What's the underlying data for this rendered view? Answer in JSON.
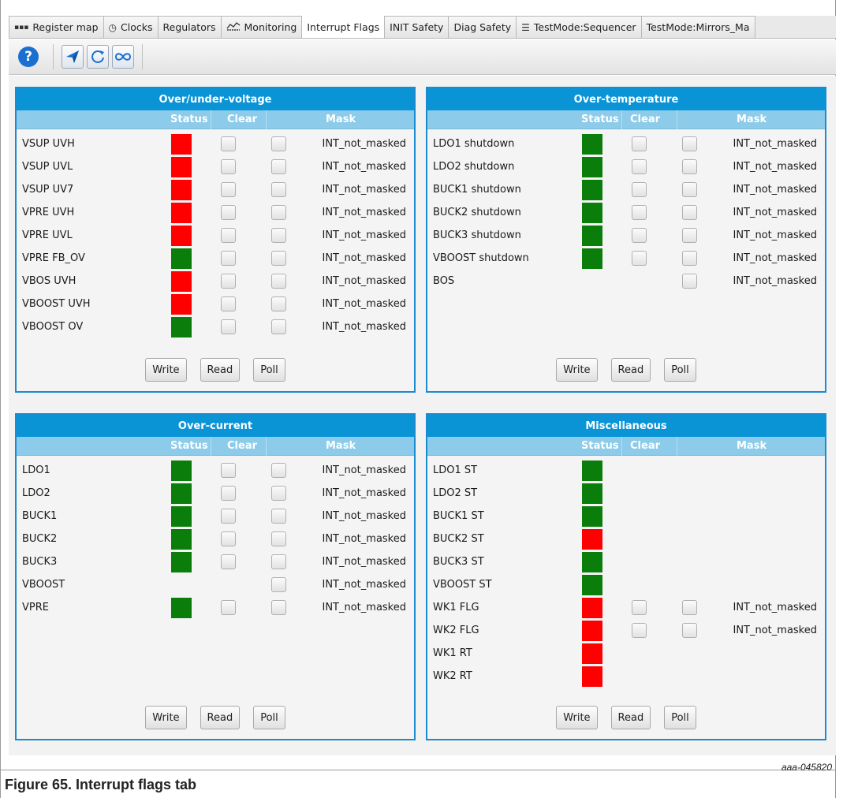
{
  "tabs": [
    {
      "label": "Register map",
      "icon": "register-map-icon"
    },
    {
      "label": "Clocks",
      "icon": "clock-icon"
    },
    {
      "label": "Regulators",
      "icon": ""
    },
    {
      "label": "Monitoring",
      "icon": "monitoring-icon"
    },
    {
      "label": "Interrupt Flags",
      "icon": "",
      "active": true
    },
    {
      "label": "INIT Safety",
      "icon": ""
    },
    {
      "label": "Diag Safety",
      "icon": ""
    },
    {
      "label": "TestMode:Sequencer",
      "icon": "list-icon"
    },
    {
      "label": "TestMode:Mirrors_Ma",
      "icon": ""
    }
  ],
  "toolbar": {
    "help": "?",
    "icons": [
      "help-icon",
      "send-icon",
      "refresh-icon",
      "infinity-icon"
    ]
  },
  "columns": {
    "status": "Status",
    "clear": "Clear",
    "mask": "Mask"
  },
  "buttons": {
    "write": "Write",
    "read": "Read",
    "poll": "Poll"
  },
  "colors": {
    "active_red": "#ff0000",
    "ok_green": "#0a7d0a",
    "header_blue": "#0a94d6",
    "subheader_blue": "#8ccbe9"
  },
  "panels": {
    "over_under_voltage": {
      "title": "Over/under-voltage",
      "rows": [
        {
          "name": "VSUP UVH",
          "status": "red",
          "clear": true,
          "mask": "INT_not_masked"
        },
        {
          "name": "VSUP UVL",
          "status": "red",
          "clear": true,
          "mask": "INT_not_masked"
        },
        {
          "name": "VSUP UV7",
          "status": "red",
          "clear": true,
          "mask": "INT_not_masked"
        },
        {
          "name": "VPRE UVH",
          "status": "red",
          "clear": true,
          "mask": "INT_not_masked"
        },
        {
          "name": "VPRE UVL",
          "status": "red",
          "clear": true,
          "mask": "INT_not_masked"
        },
        {
          "name": "VPRE FB_OV",
          "status": "green",
          "clear": true,
          "mask": "INT_not_masked"
        },
        {
          "name": "VBOS UVH",
          "status": "red",
          "clear": true,
          "mask": "INT_not_masked"
        },
        {
          "name": "VBOOST UVH",
          "status": "red",
          "clear": true,
          "mask": "INT_not_masked"
        },
        {
          "name": "VBOOST OV",
          "status": "green",
          "clear": true,
          "mask": "INT_not_masked"
        }
      ]
    },
    "over_temperature": {
      "title": "Over-temperature",
      "rows": [
        {
          "name": "LDO1 shutdown",
          "status": "green",
          "clear": true,
          "mask": "INT_not_masked"
        },
        {
          "name": "LDO2 shutdown",
          "status": "green",
          "clear": true,
          "mask": "INT_not_masked"
        },
        {
          "name": "BUCK1 shutdown",
          "status": "green",
          "clear": true,
          "mask": "INT_not_masked"
        },
        {
          "name": "BUCK2 shutdown",
          "status": "green",
          "clear": true,
          "mask": "INT_not_masked"
        },
        {
          "name": "BUCK3 shutdown",
          "status": "green",
          "clear": true,
          "mask": "INT_not_masked"
        },
        {
          "name": "VBOOST shutdown",
          "status": "green",
          "clear": true,
          "mask": "INT_not_masked"
        },
        {
          "name": "BOS",
          "status": "",
          "clear": false,
          "mask": "INT_not_masked"
        }
      ]
    },
    "over_current": {
      "title": "Over-current",
      "rows": [
        {
          "name": "LDO1",
          "status": "green",
          "clear": true,
          "mask": "INT_not_masked"
        },
        {
          "name": "LDO2",
          "status": "green",
          "clear": true,
          "mask": "INT_not_masked"
        },
        {
          "name": "BUCK1",
          "status": "green",
          "clear": true,
          "mask": "INT_not_masked"
        },
        {
          "name": "BUCK2",
          "status": "green",
          "clear": true,
          "mask": "INT_not_masked"
        },
        {
          "name": "BUCK3",
          "status": "green",
          "clear": true,
          "mask": "INT_not_masked"
        },
        {
          "name": "VBOOST",
          "status": "",
          "clear": false,
          "mask": "INT_not_masked"
        },
        {
          "name": "VPRE",
          "status": "green",
          "clear": true,
          "mask": "INT_not_masked"
        }
      ]
    },
    "miscellaneous": {
      "title": "Miscellaneous",
      "rows": [
        {
          "name": "LDO1 ST",
          "status": "green",
          "clear": false,
          "mask": ""
        },
        {
          "name": "LDO2 ST",
          "status": "green",
          "clear": false,
          "mask": ""
        },
        {
          "name": "BUCK1 ST",
          "status": "green",
          "clear": false,
          "mask": ""
        },
        {
          "name": "BUCK2 ST",
          "status": "red",
          "clear": false,
          "mask": ""
        },
        {
          "name": "BUCK3 ST",
          "status": "green",
          "clear": false,
          "mask": ""
        },
        {
          "name": "VBOOST ST",
          "status": "green",
          "clear": false,
          "mask": ""
        },
        {
          "name": "WK1 FLG",
          "status": "red",
          "clear": true,
          "mask": "INT_not_masked"
        },
        {
          "name": "WK2 FLG",
          "status": "red",
          "clear": true,
          "mask": "INT_not_masked"
        },
        {
          "name": "WK1 RT",
          "status": "red",
          "clear": false,
          "mask": ""
        },
        {
          "name": "WK2 RT",
          "status": "red",
          "clear": false,
          "mask": ""
        }
      ]
    }
  },
  "figure": {
    "id": "aaa-045820",
    "caption": "Figure 65.  Interrupt flags tab"
  }
}
